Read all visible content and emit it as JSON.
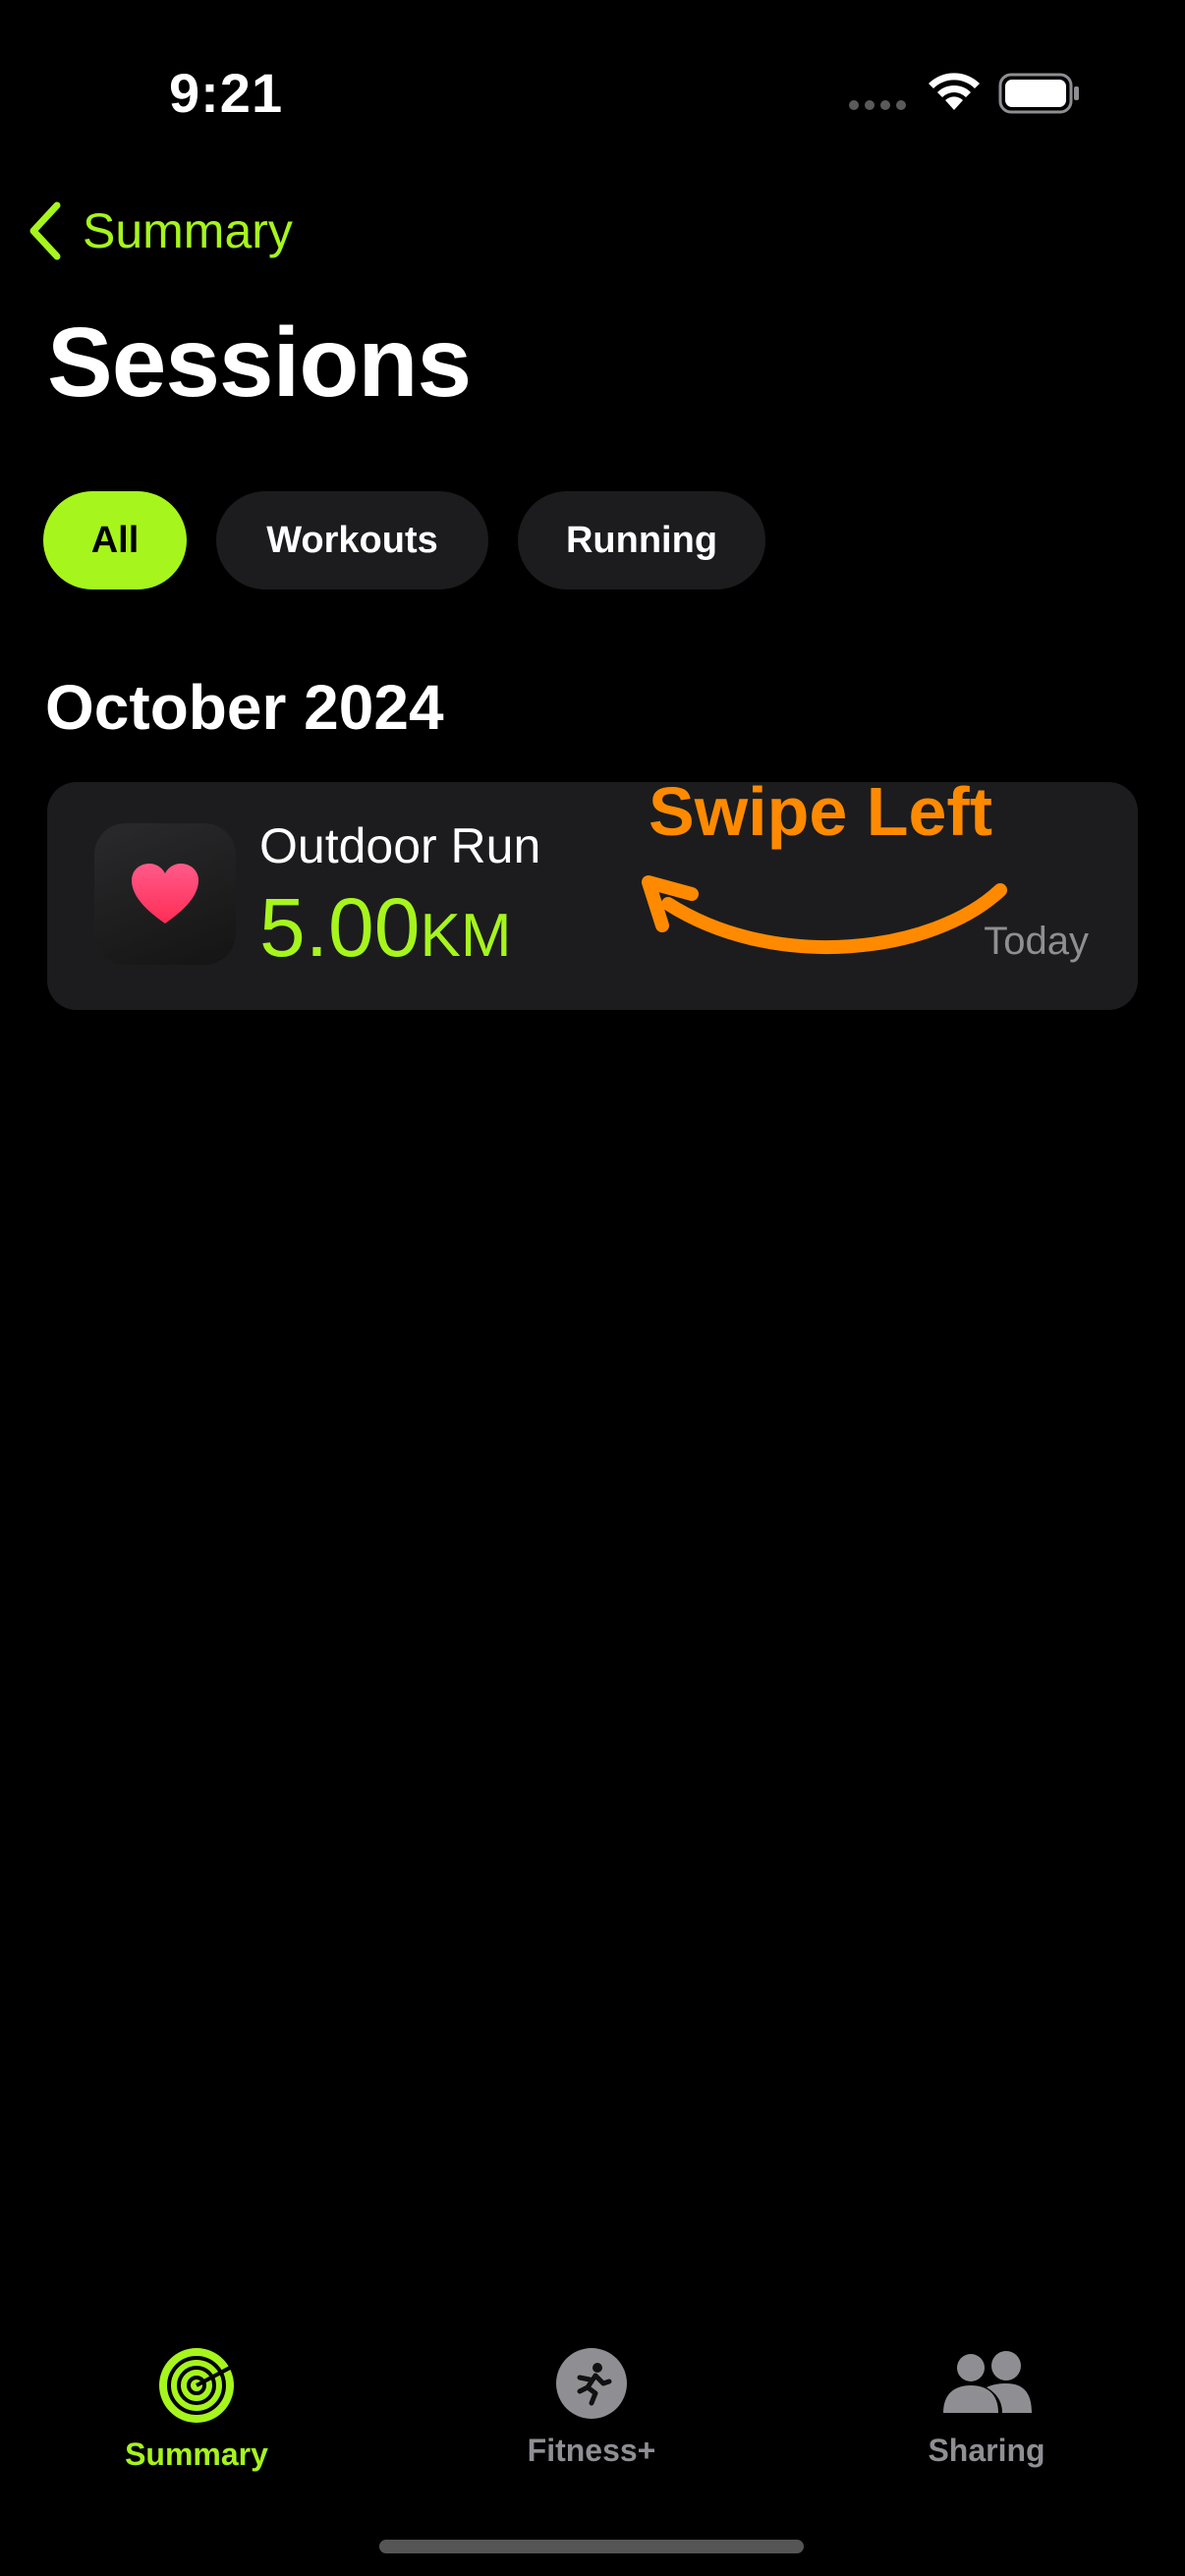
{
  "status_bar": {
    "time": "9:21"
  },
  "nav": {
    "back_label": "Summary"
  },
  "page_title": "Sessions",
  "filters": [
    {
      "label": "All",
      "selected": true
    },
    {
      "label": "Workouts",
      "selected": false
    },
    {
      "label": "Running",
      "selected": false
    }
  ],
  "section": {
    "title": "October 2024"
  },
  "sessions": [
    {
      "name": "Outdoor Run",
      "distance_value": "5.00",
      "distance_unit": "KM",
      "date": "Today",
      "icon": "heart-icon"
    }
  ],
  "annotation": {
    "text": "Swipe Left"
  },
  "tabs": [
    {
      "label": "Summary",
      "icon": "activity-rings-icon",
      "selected": true
    },
    {
      "label": "Fitness+",
      "icon": "runner-icon",
      "selected": false
    },
    {
      "label": "Sharing",
      "icon": "people-icon",
      "selected": false
    }
  ],
  "colors": {
    "accent": "#a6f51c",
    "annotation": "#ff8a00",
    "card": "#1c1c1e",
    "background": "#000000"
  }
}
